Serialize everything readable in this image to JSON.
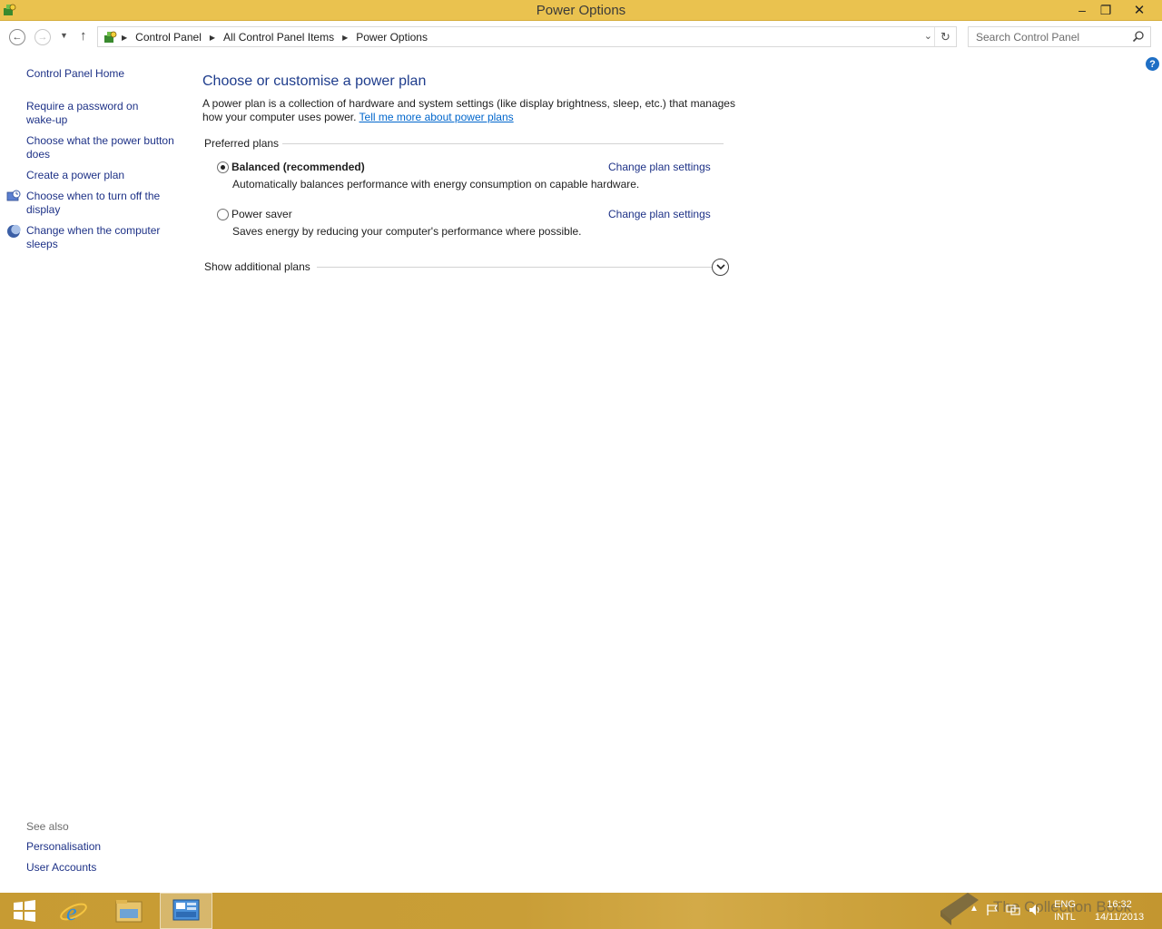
{
  "window": {
    "title": "Power Options",
    "minimize_glyph": "–",
    "maximize_glyph": "❐",
    "close_glyph": "✕"
  },
  "nav": {
    "back_glyph": "←",
    "forward_glyph": "→",
    "recent_glyph": "▼",
    "up_glyph": "↑",
    "breadcrumb": [
      "Control Panel",
      "All Control Panel Items",
      "Power Options"
    ],
    "dropdown_glyph": "⌵",
    "refresh_glyph": "↻"
  },
  "search": {
    "placeholder": "Search Control Panel"
  },
  "left_pane": {
    "home": "Control Panel Home",
    "links": [
      "Require a password on wake-up",
      "Choose what the power button does",
      "Create a power plan",
      "Choose when to turn off the display",
      "Change when the computer sleeps"
    ],
    "see_also_label": "See also",
    "see_also": [
      "Personalisation",
      "User Accounts"
    ]
  },
  "main": {
    "heading": "Choose or customise a power plan",
    "description": "A power plan is a collection of hardware and system settings (like display brightness, sleep, etc.) that manages how your computer uses power.",
    "learn_more": "Tell me more about power plans",
    "preferred_plans_label": "Preferred plans",
    "plans": [
      {
        "name": "Balanced (recommended)",
        "description": "Automatically balances performance with energy consumption on capable hardware.",
        "selected": true,
        "link": "Change plan settings"
      },
      {
        "name": "Power saver",
        "description": "Saves energy by reducing your computer's performance where possible.",
        "selected": false,
        "link": "Change plan settings"
      }
    ],
    "show_additional": "Show additional plans"
  },
  "help_glyph": "?",
  "taskbar": {
    "language": "ENG",
    "layout": "INTL",
    "time": "16:32",
    "date": "14/11/2013",
    "watermark": "The Collection Book"
  },
  "colors": {
    "title_bar": "#eac24f",
    "taskbar": "#c99e37",
    "link": "#1e3287",
    "heading": "#1e3c8c"
  }
}
